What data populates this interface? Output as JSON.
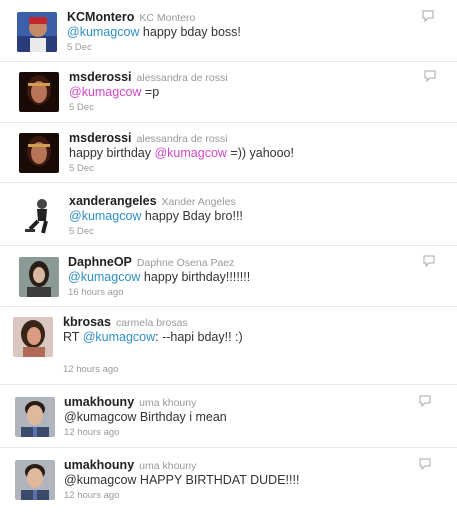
{
  "tweets": [
    {
      "username": "KCMontero",
      "fullname": "KC Montero",
      "mention": "@kumagcow",
      "mention_style": "blue",
      "before": "",
      "after": " happy bday boss!",
      "time": "5 Dec",
      "reply": true
    },
    {
      "username": "msderossi",
      "fullname": "alessandra de rossi",
      "mention": "@kumagcow",
      "mention_style": "pink",
      "before": "",
      "after": " =p",
      "time": "5 Dec",
      "reply": true
    },
    {
      "username": "msderossi",
      "fullname": "alessandra de rossi",
      "mention": "@kumagcow",
      "mention_style": "pink",
      "before": "happy birthday ",
      "after": " =)) yahooo!",
      "time": "5 Dec",
      "reply": false
    },
    {
      "username": "xanderangeles",
      "fullname": "Xander Angeles",
      "mention": "@kumagcow",
      "mention_style": "blue",
      "before": "",
      "after": " happy Bday bro!!!",
      "time": "5 Dec",
      "reply": false
    },
    {
      "username": "DaphneOP",
      "fullname": "Daphne Osena Paez",
      "mention": "@kumagcow",
      "mention_style": "blue",
      "before": "",
      "after": " happy birthday!!!!!!!",
      "time": "16 hours ago",
      "reply": true
    },
    {
      "username": "kbrosas",
      "fullname": "carmela brosas",
      "mention": "@kumagcow",
      "mention_style": "blue",
      "before": "RT ",
      "after": ": --hapi bday!! :)",
      "time": "12 hours ago",
      "reply": false
    },
    {
      "username": "umakhouny",
      "fullname": "uma khouny",
      "mention": "@kumagcow",
      "mention_style": "plain",
      "before": "",
      "after": " Birthday i mean",
      "time": "12 hours ago",
      "reply": true
    },
    {
      "username": "umakhouny",
      "fullname": "uma khouny",
      "mention": "@kumagcow",
      "mention_style": "plain",
      "before": "",
      "after": " HAPPY BIRTHDAT DUDE!!!!",
      "time": "12 hours ago",
      "reply": true
    }
  ],
  "colors": {
    "link_blue": "#2f8fc6",
    "link_pink": "#d148c6",
    "username": "#222222",
    "meta": "#999999",
    "text": "#333333"
  }
}
